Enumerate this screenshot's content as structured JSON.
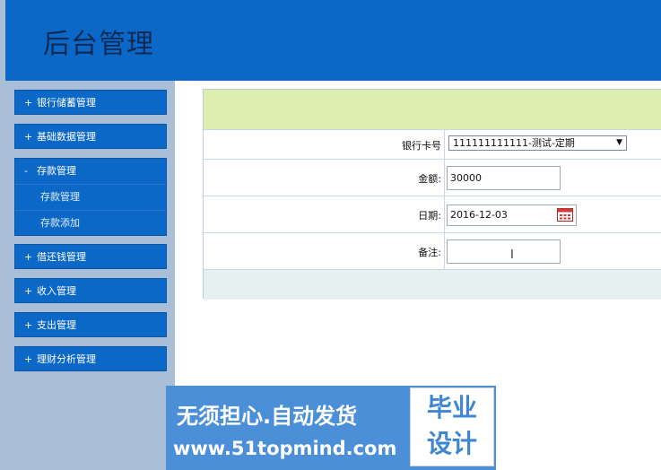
{
  "header": {
    "title": "后台管理"
  },
  "sidebar": {
    "items": [
      {
        "sign": "+",
        "label": "银行储蓄管理"
      },
      {
        "sign": "+",
        "label": "基础数据管理"
      },
      {
        "sign": "-",
        "label": "存款管理",
        "sub": [
          "存款管理",
          "存款添加"
        ]
      },
      {
        "sign": "+",
        "label": "借还钱管理"
      },
      {
        "sign": "+",
        "label": "收入管理"
      },
      {
        "sign": "+",
        "label": "支出管理"
      },
      {
        "sign": "+",
        "label": "理财分析管理"
      }
    ]
  },
  "form": {
    "card_label": "银行卡号",
    "card_value": "111111111111-测试-定期",
    "amount_label": "金额:",
    "amount_value": "30000",
    "date_label": "日期:",
    "date_value": "2016-12-03",
    "remark_label": "备注:",
    "remark_value": ""
  },
  "watermark": {
    "slogan": "无须担心.自动发货",
    "url": "www.51topmind.com",
    "box_line1": "毕业",
    "box_line2": "设计"
  },
  "colors": {
    "header_bg": "#0c68c6",
    "sidebar_bg": "#a9bfd8",
    "menu_bg": "#0c68c6",
    "form_top_bg": "#dcedb0"
  },
  "icons": {
    "select_arrow": "chevron-down-icon",
    "date": "calendar-icon",
    "text_cursor": "text-cursor-icon"
  }
}
